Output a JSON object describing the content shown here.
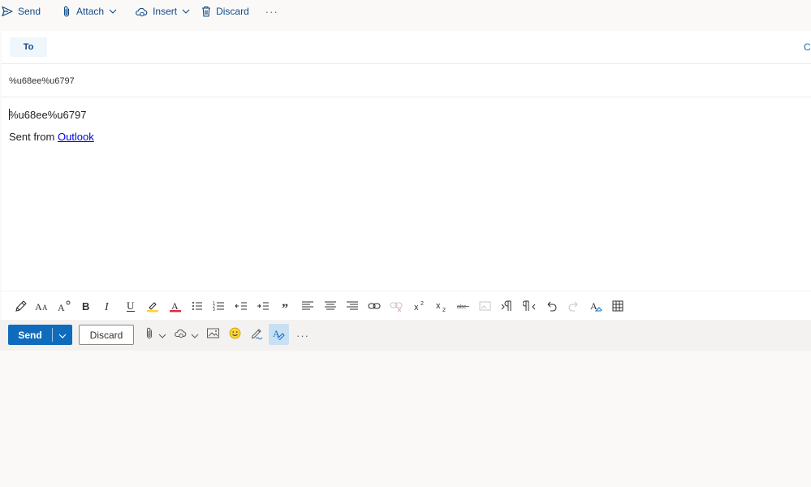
{
  "toolbar": {
    "send_label": "Send",
    "attach_label": "Attach",
    "insert_label": "Insert",
    "discard_label": "Discard",
    "more_label": "···"
  },
  "compose": {
    "to_label": "To",
    "cc_label": "C",
    "subject_value": "%u68ee%u6797",
    "body_line1": "%u68ee%u6797",
    "signature_prefix": "Sent from ",
    "signature_link": "Outlook"
  },
  "format_ribbon": {
    "icons": [
      "format-painter-icon",
      "font-size-icon",
      "grow-font-icon",
      "bold-icon",
      "italic-icon",
      "underline-icon",
      "highlight-icon",
      "font-color-icon",
      "bullets-icon",
      "numbering-icon",
      "decrease-indent-icon",
      "increase-indent-icon",
      "quote-icon",
      "align-left-icon",
      "align-center-icon",
      "align-right-icon",
      "insert-link-icon",
      "remove-link-icon",
      "superscript-icon",
      "subscript-icon",
      "strikethrough-icon",
      "insert-picture-inline-icon",
      "ltr-icon",
      "rtl-icon",
      "undo-icon",
      "redo-icon",
      "clear-formatting-icon",
      "insert-table-icon"
    ]
  },
  "actions": {
    "send_label": "Send",
    "discard_label": "Discard",
    "more_label": "···"
  },
  "colors": {
    "accent": "#0f6cbd",
    "toolbar_text": "#0f4a85",
    "selected_bg": "#c7e0f4",
    "highlight_yellow": "#ffd335",
    "font_color_red": "#d13438"
  }
}
